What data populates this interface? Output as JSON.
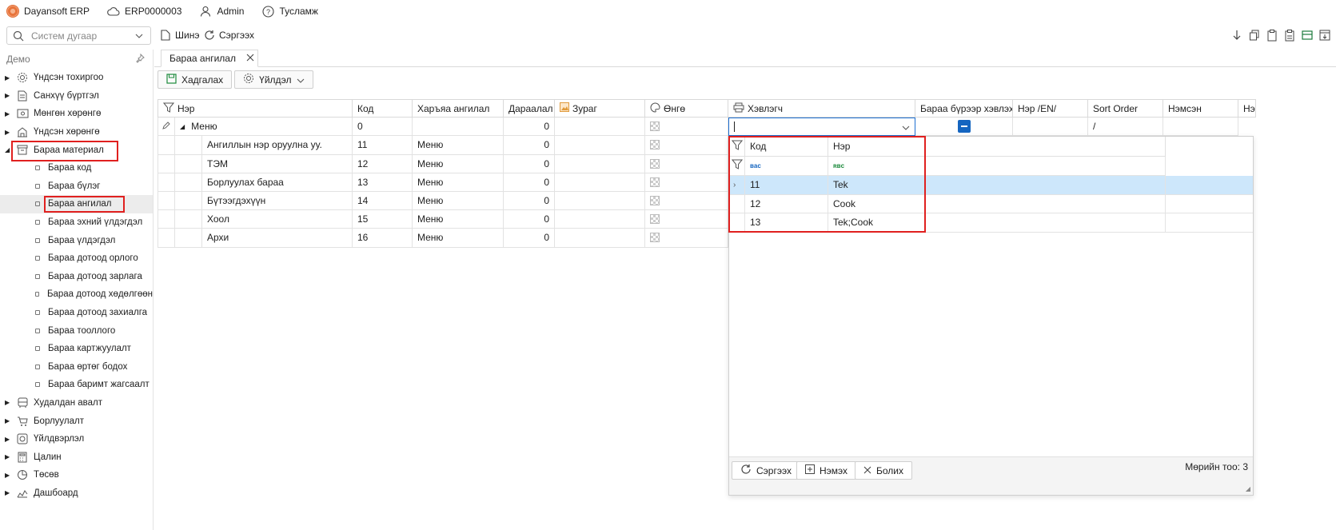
{
  "topbar": {
    "app_name": "Dayansoft ERP",
    "system_code": "ERP0000003",
    "user": "Admin",
    "help": "Тусламж"
  },
  "toolbar": {
    "search_placeholder": "Систем дугаар",
    "new_label": "Шинэ",
    "refresh_label": "Сэргээх"
  },
  "sidebar": {
    "header": "Демо",
    "items": [
      {
        "label": "Үндсэн тохиргоо",
        "icon": "gear-icon"
      },
      {
        "label": "Санхүү бүртгэл",
        "icon": "document-icon"
      },
      {
        "label": "Мөнгөн хөрөнгө",
        "icon": "cash-icon"
      },
      {
        "label": "Үндсэн хөрөнгө",
        "icon": "building-icon"
      },
      {
        "label": "Бараа материал",
        "icon": "box-icon"
      }
    ],
    "sub_items": [
      "Бараа код",
      "Бараа бүлэг",
      "Бараа ангилал",
      "Бараа эхний үлдэгдэл",
      "Бараа үлдэгдэл",
      "Бараа дотоод орлого",
      "Бараа дотоод зарлага",
      "Бараа дотоод хөдөлгөөн",
      "Бараа дотоод захиалга",
      "Бараа тооллого",
      "Бараа картжуулалт",
      "Бараа өртөг бодох",
      "Бараа баримт жагсаалт"
    ],
    "bottom_items": [
      {
        "label": "Худалдан авалт",
        "icon": "bus-icon"
      },
      {
        "label": "Борлуулалт",
        "icon": "cart-icon"
      },
      {
        "label": "Үйлдвэрлэл",
        "icon": "factory-icon"
      },
      {
        "label": "Цалин",
        "icon": "calculator-icon"
      },
      {
        "label": "Төсөв",
        "icon": "pie-icon"
      },
      {
        "label": "Дашбоард",
        "icon": "chart-icon"
      }
    ]
  },
  "tab": {
    "label": "Бараа ангилал"
  },
  "actions": {
    "save_label": "Хадгалах",
    "operation_label": "Үйлдэл"
  },
  "grid": {
    "columns": [
      "Нэр",
      "Код",
      "Харъяа ангилал",
      "Дараалал",
      "Зураг",
      "Өнгө",
      "Хэвлэгч",
      "Бараа бүрээр хэвлэх",
      "Нэр /EN/",
      "Sort Order",
      "Нэмсэн",
      "Нэ"
    ],
    "edit_row": {
      "name": "Меню",
      "code": "0",
      "order": "0",
      "sort_order": "/"
    },
    "rows": [
      {
        "name": "Ангиллын нэр оруулна уу.",
        "code": "11",
        "parent": "Меню",
        "order": "0"
      },
      {
        "name": "ТЭМ",
        "code": "12",
        "parent": "Меню",
        "order": "0"
      },
      {
        "name": "Борлуулах бараа",
        "code": "13",
        "parent": "Меню",
        "order": "0"
      },
      {
        "name": "Бүтээгдэхүүн",
        "code": "14",
        "parent": "Меню",
        "order": "0"
      },
      {
        "name": "Хоол",
        "code": "15",
        "parent": "Меню",
        "order": "0"
      },
      {
        "name": "Архи",
        "code": "16",
        "parent": "Меню",
        "order": "0"
      }
    ]
  },
  "popup": {
    "columns": [
      "Код",
      "Нэр"
    ],
    "rows": [
      {
        "code": "11",
        "name": "Tek"
      },
      {
        "code": "12",
        "name": "Cook"
      },
      {
        "code": "13",
        "name": "Tek;Cook"
      }
    ],
    "refresh_label": "Сэргээх",
    "add_label": "Нэмэх",
    "cancel_label": "Болих",
    "row_count": "Мөрийн тоо: 3"
  },
  "colors": {
    "highlight": "#e0201f",
    "selection": "#cde7fb",
    "checkbox": "#1565c0"
  }
}
